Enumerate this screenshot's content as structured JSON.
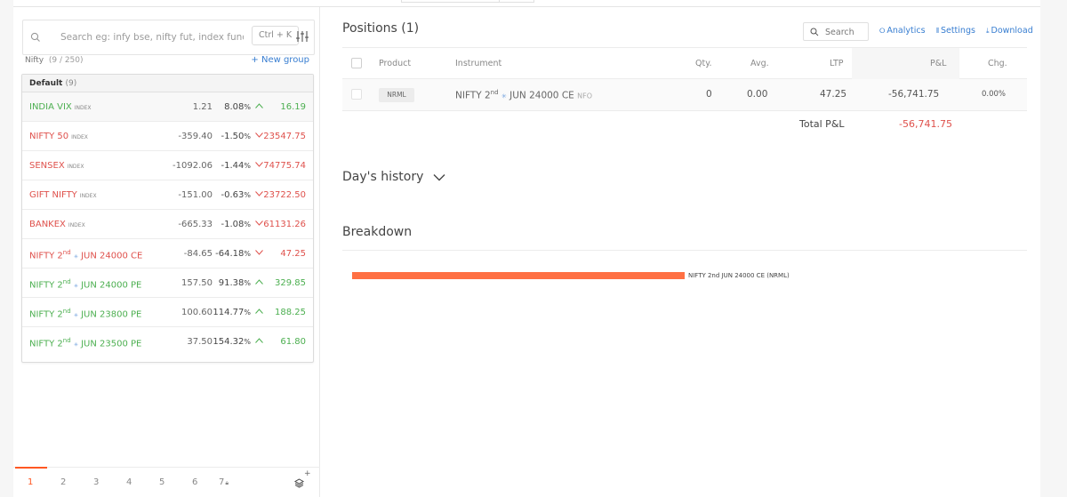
{
  "watchlist": {
    "search_placeholder": "Search eg: infy bse, nifty fut, index fund, etc",
    "shortcut": "Ctrl + K",
    "list_name": "Nifty",
    "list_count": "(9 / 250)",
    "new_group": "+ New group",
    "group_name": "Default",
    "group_count": "(9)",
    "rows": [
      {
        "name": "INDIA VIX",
        "tag": "INDEX",
        "change": "1.21",
        "pct": "8.08",
        "ltp": "16.19",
        "dir": "up"
      },
      {
        "name": "NIFTY 50",
        "tag": "INDEX",
        "change": "-359.40",
        "pct": "-1.50",
        "ltp": "23547.75",
        "dir": "down"
      },
      {
        "name": "SENSEX",
        "tag": "INDEX",
        "change": "-1092.06",
        "pct": "-1.44",
        "ltp": "74775.74",
        "dir": "down"
      },
      {
        "name": "GIFT NIFTY",
        "tag": "INDEX",
        "change": "-151.00",
        "pct": "-0.63",
        "ltp": "23722.50",
        "dir": "down"
      },
      {
        "name": "BANKEX",
        "tag": "INDEX",
        "change": "-665.33",
        "pct": "-1.08",
        "ltp": "61131.26",
        "dir": "down"
      },
      {
        "name_pre": "NIFTY 2",
        "name_sup": "nd",
        "name_post": "JUN 24000 CE",
        "change": "-84.65",
        "pct": "-64.18",
        "ltp": "47.25",
        "dir": "down"
      },
      {
        "name_pre": "NIFTY 2",
        "name_sup": "nd",
        "name_post": "JUN 24000 PE",
        "change": "157.50",
        "pct": "91.38",
        "ltp": "329.85",
        "dir": "up"
      },
      {
        "name_pre": "NIFTY 2",
        "name_sup": "nd",
        "name_post": "JUN 23800 PE",
        "change": "100.60",
        "pct": "114.77",
        "ltp": "188.25",
        "dir": "up"
      },
      {
        "name_pre": "NIFTY 2",
        "name_sup": "nd",
        "name_post": "JUN 23500 PE",
        "change": "37.50",
        "pct": "154.32",
        "ltp": "61.80",
        "dir": "up"
      }
    ],
    "pct_sign": "%",
    "pages": [
      "1",
      "2",
      "3",
      "4",
      "5",
      "6",
      "7"
    ],
    "active_page": "1"
  },
  "positions": {
    "title": "Positions (1)",
    "search_placeholder": "Search",
    "links": {
      "analytics": "Analytics",
      "settings": "Settings",
      "download": "Download"
    },
    "columns": {
      "product": "Product",
      "instrument": "Instrument",
      "qty": "Qty.",
      "avg": "Avg.",
      "ltp": "LTP",
      "pnl": "P&L",
      "chg": "Chg."
    },
    "row": {
      "product": "NRML",
      "instrument_pre": "NIFTY 2",
      "instrument_sup": "nd",
      "instrument_post": "JUN 24000 CE",
      "exchange": "NFO",
      "qty": "0",
      "avg": "0.00",
      "ltp": "47.25",
      "pnl": "-56,741.75",
      "chg": "0.00%"
    },
    "total_label": "Total P&L",
    "total_value": "-56,741.75"
  },
  "days_history": {
    "title": "Day's history"
  },
  "breakdown": {
    "title": "Breakdown",
    "bar_label": "NIFTY 2nd JUN 24000 CE (NRML)",
    "bar_fraction": 1.0
  },
  "colors": {
    "up": "#4caf50",
    "down": "#df514c",
    "accent": "#ff5722",
    "link": "#387ed1",
    "bar": "#ff7043"
  }
}
